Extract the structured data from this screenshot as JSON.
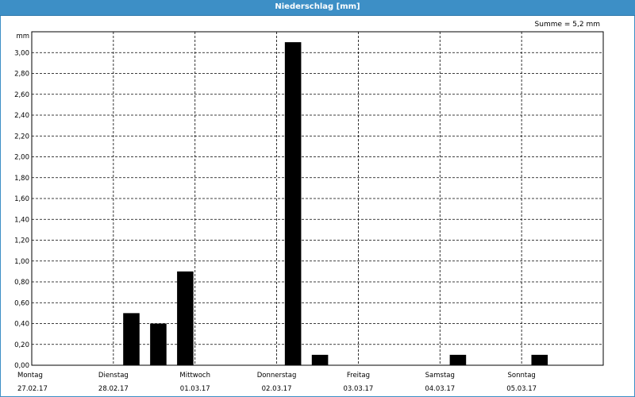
{
  "title": "Niederschlag [mm]",
  "summary": "Summe = 5,2 mm",
  "chart_data": {
    "type": "bar",
    "title": "Niederschlag [mm]",
    "ylabel": "mm",
    "ylim": [
      0,
      3.2
    ],
    "yticks": [
      0,
      0.2,
      0.4,
      0.6,
      0.8,
      1.0,
      1.2,
      1.4,
      1.6,
      1.8,
      2.0,
      2.2,
      2.4,
      2.6,
      2.8,
      3.0
    ],
    "ytick_labels": [
      "0,00",
      "0,20",
      "0,40",
      "0,60",
      "0,80",
      "1,00",
      "1,20",
      "1,40",
      "1,60",
      "1,80",
      "2,00",
      "2,20",
      "2,40",
      "2,60",
      "2,80",
      "3,00"
    ],
    "days": [
      {
        "name": "Montag",
        "date": "27.02.17"
      },
      {
        "name": "Dienstag",
        "date": "28.02.17"
      },
      {
        "name": "Mittwoch",
        "date": "01.03.17"
      },
      {
        "name": "Donnerstag",
        "date": "02.03.17"
      },
      {
        "name": "Freitag",
        "date": "03.03.17"
      },
      {
        "name": "Samstag",
        "date": "04.03.17"
      },
      {
        "name": "Sonntag",
        "date": "05.03.17"
      }
    ],
    "x_range_days": [
      0,
      7
    ],
    "bar_width_days": 0.2,
    "bars": [
      {
        "x_days": 1.12,
        "value": 0.5
      },
      {
        "x_days": 1.45,
        "value": 0.4
      },
      {
        "x_days": 1.78,
        "value": 0.9
      },
      {
        "x_days": 3.1,
        "value": 3.1
      },
      {
        "x_days": 3.43,
        "value": 0.1
      },
      {
        "x_days": 5.12,
        "value": 0.1
      },
      {
        "x_days": 6.12,
        "value": 0.1
      }
    ],
    "grid": true,
    "bar_color": "#000000"
  }
}
